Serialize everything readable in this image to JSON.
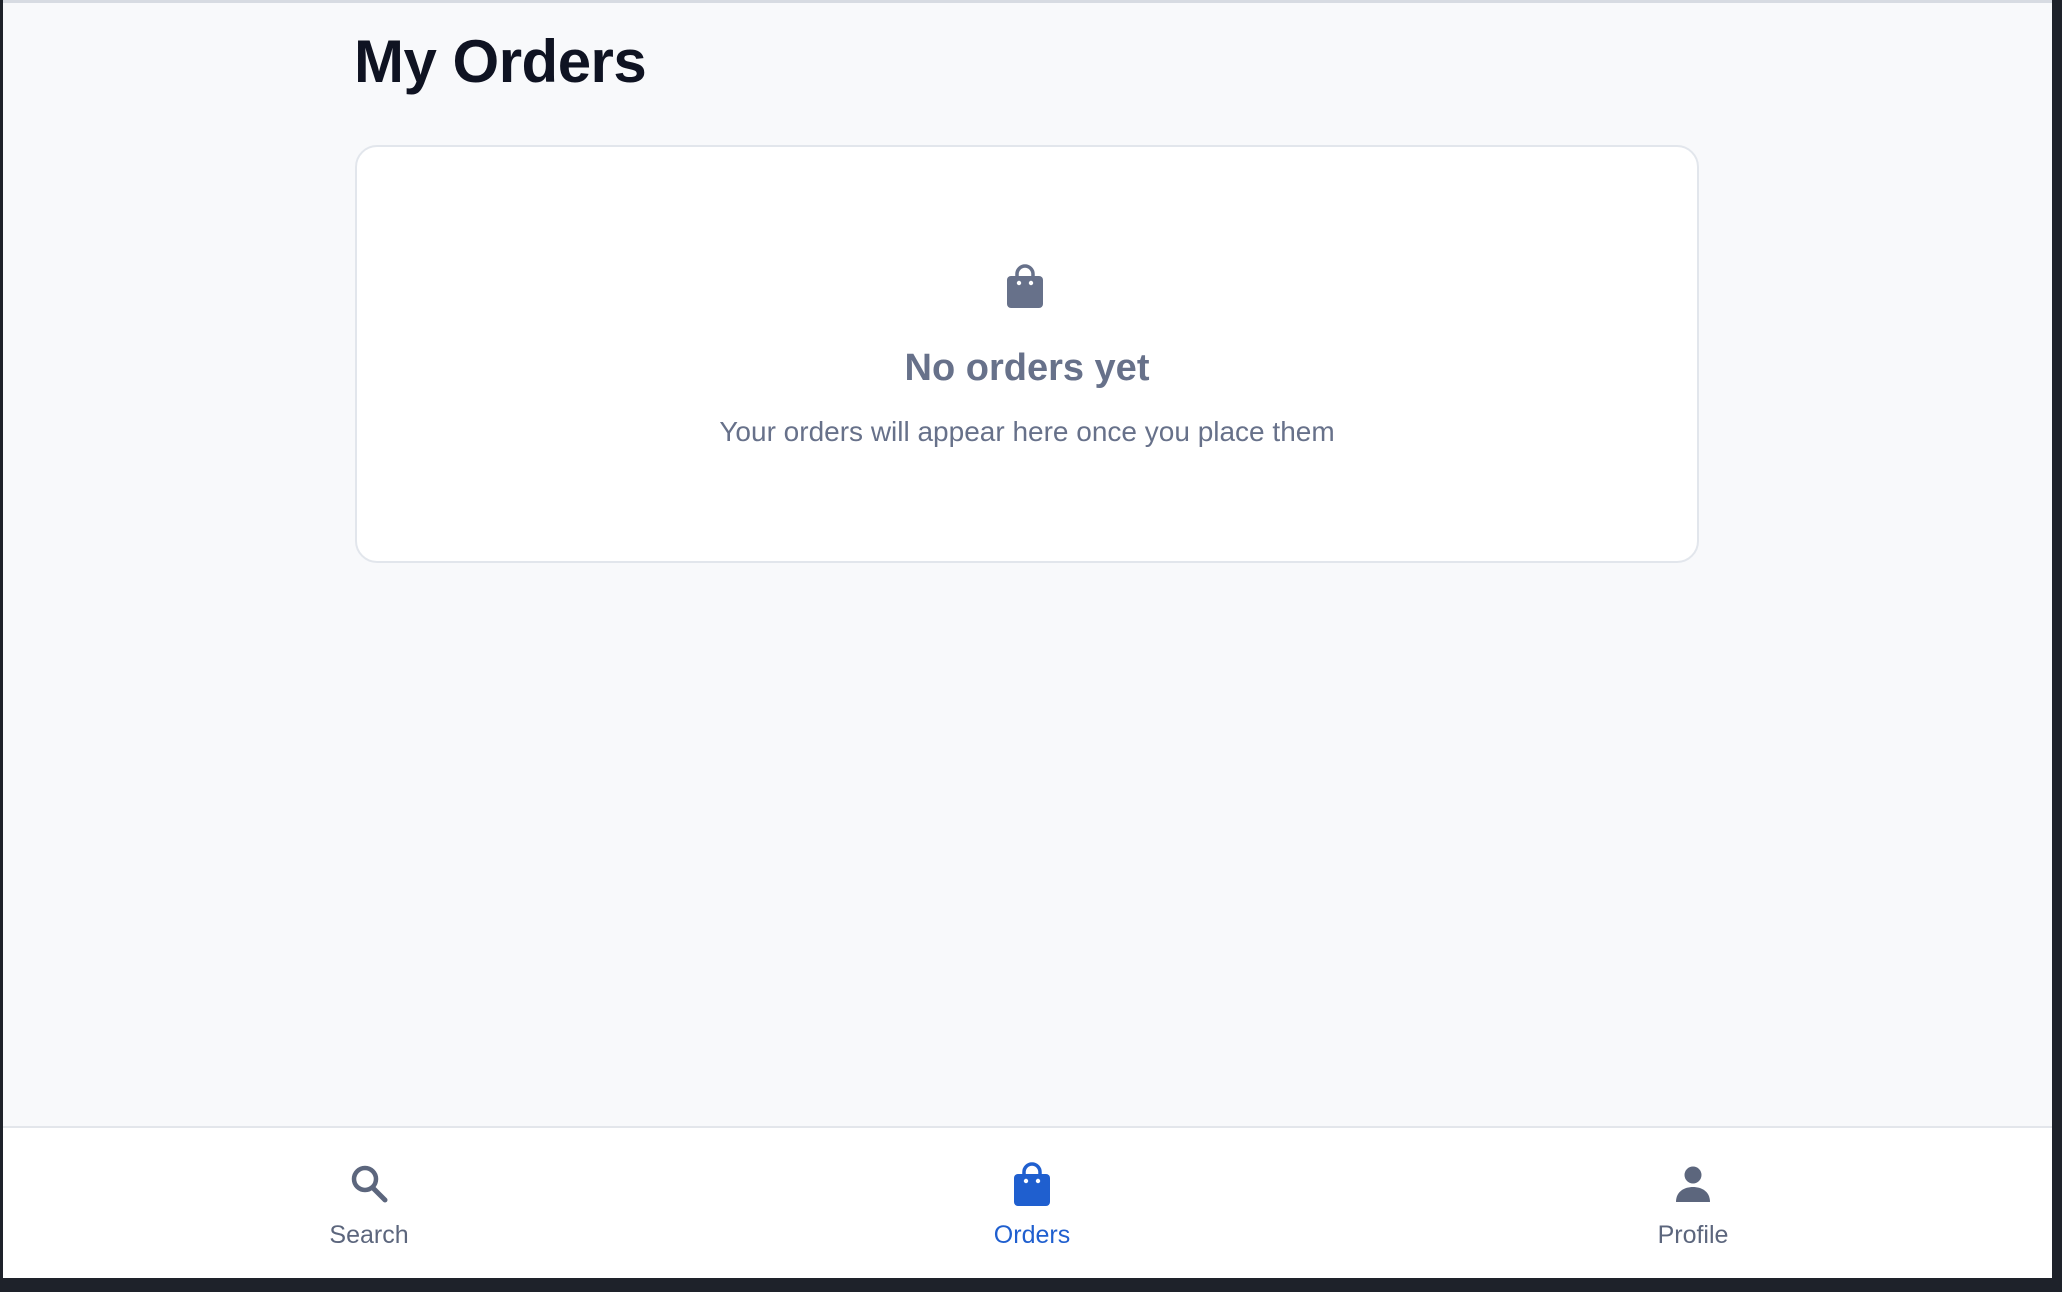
{
  "page": {
    "title": "My Orders"
  },
  "empty_state": {
    "icon": "shopping-bag-icon",
    "title": "No orders yet",
    "description": "Your orders will appear here once you place them"
  },
  "bottom_nav": {
    "items": [
      {
        "label": "Search",
        "icon": "search-icon",
        "active": false
      },
      {
        "label": "Orders",
        "icon": "shopping-bag-icon",
        "active": true
      },
      {
        "label": "Profile",
        "icon": "person-icon",
        "active": false
      }
    ]
  },
  "colors": {
    "background": "#f8f9fb",
    "title_text": "#0f1322",
    "muted_text": "#67718a",
    "active_accent": "#1f5fcf",
    "inactive_nav": "#5c667d",
    "card_background": "#ffffff",
    "card_border": "#e2e6ec"
  }
}
